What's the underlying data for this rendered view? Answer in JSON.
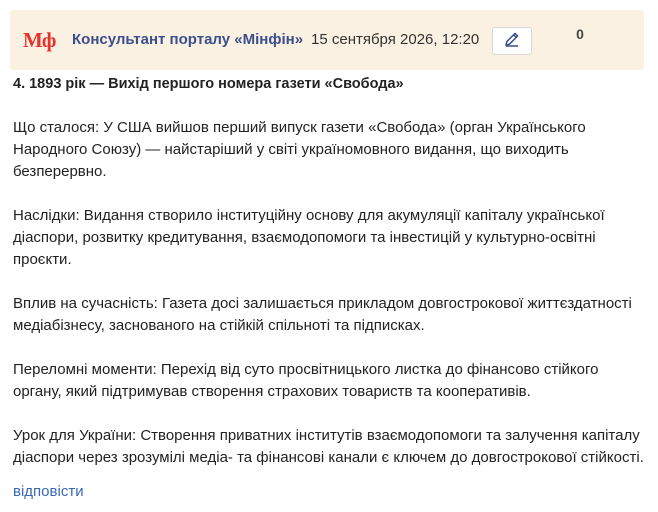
{
  "header": {
    "logo_text": "Мф",
    "author": "Консультант порталу «Мінфін»",
    "date": "15 сентября 2026, 12:20",
    "edit_icon": "pencil-icon",
    "counter": "0"
  },
  "post": {
    "heading": "4. 1893 рік — Вихід першого номера газети «Свобода»",
    "paragraphs": [
      "Що сталося: У США вийшов перший випуск газети «Свобода» (орган Українського Народного Союзу) — найстаріший у світі україномовного видання, що виходить безперервно.",
      "Наслідки: Видання створило інституційну основу для акумуляції капіталу української діаспори, розвитку кредитування, взаємодопомоги та інвестицій у культурно-освітні проєкти.",
      "Вплив на сучасність: Газета досі залишається прикладом довгострокової життєздатності медіабізнесу, заснованого на стійкій спільноті та підписках.",
      "Переломні моменти: Перехід від суто просвітницького листка до фінансово стійкого органу, який підтримував створення страхових товариств та кооперативів.",
      "Урок для України: Створення приватних інститутів взаємодопомоги та залучення капіталу діаспори через зрозумілі медіа- та фінансові канали є ключем до довгострокової стійкості."
    ],
    "reply_label": "відповісти"
  },
  "colors": {
    "header_bg": "#fbf1e3",
    "logo": "#e8332a",
    "author": "#3a4f8c",
    "link": "#3a68b6"
  }
}
